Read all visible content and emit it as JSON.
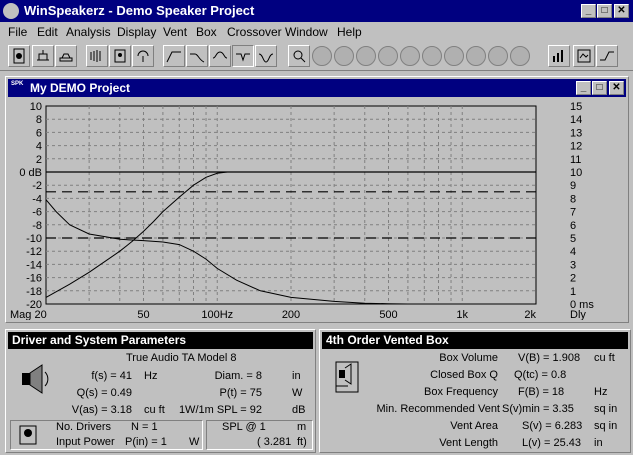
{
  "app": {
    "title": "WinSpeakerz - Demo Speaker Project"
  },
  "menu": [
    "File",
    "Edit",
    "Analysis",
    "Display",
    "Vent",
    "Box",
    "Crossover",
    "Window",
    "Help"
  ],
  "graph_window": {
    "title": "My DEMO Project",
    "icon_label": "SPK"
  },
  "chart_data": {
    "type": "line",
    "xscale": "log",
    "xlim": [
      20,
      2000
    ],
    "x_ticks": [
      "Mag 20",
      "50",
      "100Hz",
      "200",
      "500",
      "1k",
      "2k"
    ],
    "left_ticks": [
      "10",
      "8",
      "6",
      "4",
      "2",
      "0 dB",
      "-2",
      "-4",
      "-6",
      "-8",
      "-10",
      "-12",
      "-14",
      "-16",
      "-18",
      "-20"
    ],
    "right_ticks": [
      "15",
      "14",
      "13",
      "12",
      "11",
      "10",
      "9",
      "8",
      "7",
      "6",
      "5",
      "4",
      "3",
      "2",
      "1",
      "0 ms"
    ],
    "right_axis_label": "Dly",
    "ylim_left": [
      -20,
      10
    ],
    "ylim_right": [
      0,
      15
    ],
    "grid": true,
    "reference_lines_db": [
      0,
      -3,
      -10
    ],
    "series": [
      {
        "axis": "left",
        "x": [
          20,
          25,
          30,
          35,
          40,
          45,
          50,
          55,
          60,
          70,
          80,
          90,
          100,
          110,
          120,
          150,
          200,
          300,
          380
        ],
        "y": [
          -19,
          -17,
          -15.2,
          -13.5,
          -12,
          -10.5,
          -9,
          -7.5,
          -6,
          -3.8,
          -2,
          -0.8,
          -0.2,
          0,
          0,
          0,
          0,
          0,
          0
        ]
      },
      {
        "axis": "right",
        "x": [
          20,
          22,
          25,
          30,
          35,
          40,
          50,
          60,
          70,
          80,
          90,
          100,
          120,
          150,
          200,
          300,
          400,
          500,
          600
        ],
        "y": [
          7.9,
          7,
          6,
          5.3,
          5.1,
          4.9,
          4.8,
          4.7,
          4.5,
          4.0,
          3.4,
          2.7,
          1.8,
          1.0,
          0.5,
          0.2,
          0.06,
          0.02,
          0
        ]
      }
    ]
  },
  "driver_panel": {
    "title": "Driver and System Parameters",
    "model": "True Audio TA Model 8",
    "fs_label": "f(s) = 41",
    "fs_unit": "Hz",
    "qs_label": "Q(s) = 0.49",
    "vas_label": "V(as) = 3.18",
    "vas_unit": "cu ft",
    "diam_label": "Diam. = 8",
    "diam_unit": "in",
    "pt_label": "P(t) = 75",
    "pt_unit": "W",
    "spl_label": "1W/1m SPL = 92",
    "spl_unit": "dB",
    "drivers_label": "No. Drivers",
    "drivers_value": "N = 1",
    "power_label": "Input Power",
    "power_value": "P(in) = 1",
    "power_unit": "W",
    "spl_at_label": "SPL @ 1",
    "spl_at_unit": "m",
    "spl_at_ft": "( 3.281",
    "spl_at_ft_unit": "ft)"
  },
  "box_panel": {
    "title": "4th Order Vented Box",
    "rows": [
      {
        "label": "Box Volume",
        "value": "V(B) = 1.908",
        "unit": "cu ft"
      },
      {
        "label": "Closed Box Q",
        "value": "Q(tc) = 0.8",
        "unit": ""
      },
      {
        "label": "Box Frequency",
        "value": "F(B) = 18",
        "unit": "Hz"
      },
      {
        "label": "Min. Recommended Vent",
        "value": "S(v)min = 3.35",
        "unit": "sq in"
      },
      {
        "label": "Vent Area",
        "value": "S(v) = 6.283",
        "unit": "sq in"
      },
      {
        "label": "Vent Length",
        "value": "L(v) = 25.43",
        "unit": "in"
      }
    ]
  },
  "colors": {
    "titlebar": "#000080",
    "face": "#c0c0c0",
    "plot_bg": "#c0c0c0"
  }
}
